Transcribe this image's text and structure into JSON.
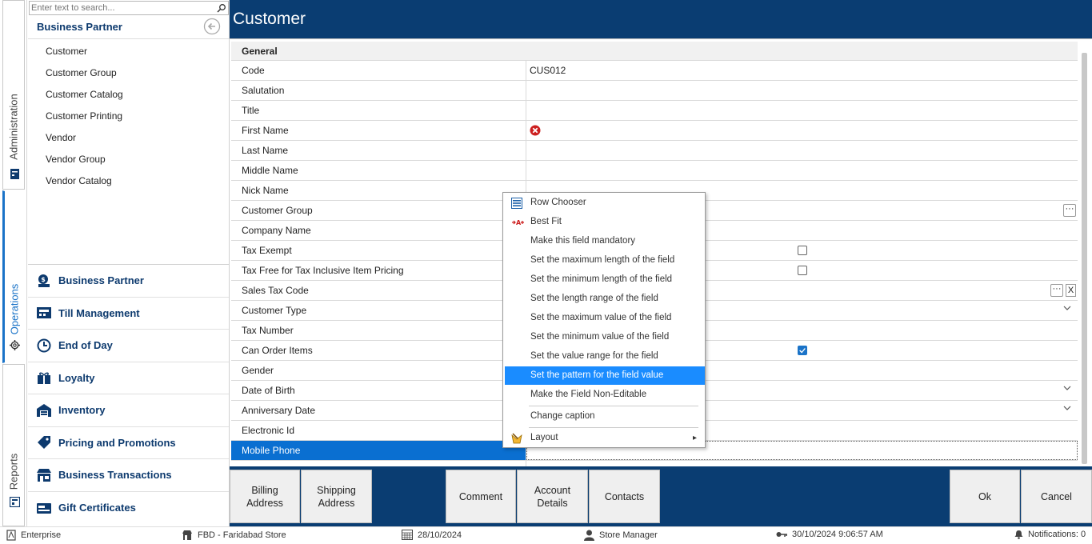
{
  "sidebar_tabs": [
    {
      "label": "Administration",
      "icon": "server-icon"
    },
    {
      "label": "Operations",
      "icon": "gear-icon"
    },
    {
      "label": "Reports",
      "icon": "report-icon"
    }
  ],
  "left_panel": {
    "search_placeholder": "Enter text to search...",
    "heading": "Business Partner",
    "items": [
      "Customer",
      "Customer Group",
      "Customer Catalog",
      "Customer Printing",
      "Vendor",
      "Vendor Group",
      "Vendor Catalog"
    ],
    "modules": [
      "Business Partner",
      "Till Management",
      "End of Day",
      "Loyalty",
      "Inventory",
      "Pricing and Promotions",
      "Business Transactions",
      "Gift Certificates"
    ]
  },
  "main": {
    "title": "Customer",
    "group": "General",
    "rows": [
      {
        "label": "Code",
        "value": "CUS012"
      },
      {
        "label": "Salutation",
        "value": ""
      },
      {
        "label": "Title",
        "value": ""
      },
      {
        "label": "First Name",
        "value": ""
      },
      {
        "label": "Last Name",
        "value": ""
      },
      {
        "label": "Middle Name",
        "value": ""
      },
      {
        "label": "Nick Name",
        "value": ""
      },
      {
        "label": "Customer Group",
        "value": ""
      },
      {
        "label": "Company Name",
        "value": ""
      },
      {
        "label": "Tax Exempt",
        "value": ""
      },
      {
        "label": "Tax Free for Tax Inclusive Item Pricing",
        "value": ""
      },
      {
        "label": "Sales Tax Code",
        "value": ""
      },
      {
        "label": "Customer Type",
        "value": ""
      },
      {
        "label": "Tax Number",
        "value": ""
      },
      {
        "label": "Can Order Items",
        "value": ""
      },
      {
        "label": "Gender",
        "value": ""
      },
      {
        "label": "Date of Birth",
        "value": ""
      },
      {
        "label": "Anniversary Date",
        "value": ""
      },
      {
        "label": "Electronic Id",
        "value": ""
      },
      {
        "label": "Mobile Phone",
        "value": ""
      }
    ],
    "ellipsis": "···",
    "clear": "X"
  },
  "context_menu": {
    "items": [
      "Row Chooser",
      "Best Fit",
      "Make this field mandatory",
      "Set the maximum length of the field",
      "Set the minimum length of the field",
      "Set the length range of the field",
      "Set the maximum value of the field",
      "Set the minimum value of the field",
      "Set the value range for the field",
      "Set the pattern for the field value",
      "Make the Field Non-Editable"
    ],
    "change_caption": "Change caption",
    "layout": "Layout",
    "submenu_arrow": "▸"
  },
  "bottom_buttons": {
    "billing": "Billing Address",
    "shipping": "Shipping Address",
    "comment": "Comment",
    "account": "Account Details",
    "contacts": "Contacts",
    "ok": "Ok",
    "cancel": "Cancel"
  },
  "status": {
    "edition": "Enterprise",
    "store": "FBD - Faridabad Store",
    "business_date": "28/10/2024",
    "user": "Store Manager",
    "timestamp": "30/10/2024 9:06:57 AM",
    "notifications": "Notifications: 0"
  },
  "colors": {
    "brand": "#0a3d72",
    "selection": "#0a6fd1",
    "menu_highlight": "#1a8cff",
    "error": "#cc1f1f"
  }
}
